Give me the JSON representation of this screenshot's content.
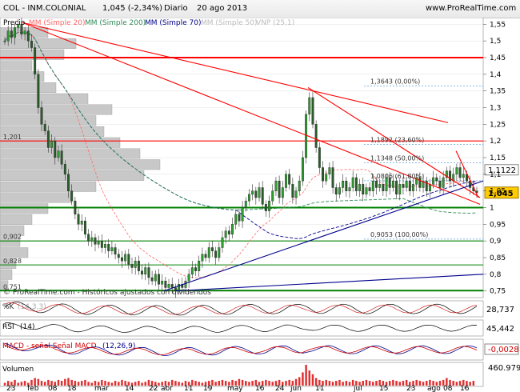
{
  "header": {
    "symbol": "COL - INM.COLONIAL",
    "quote": "1,045 (-2,34%)",
    "period": "Diario",
    "date": "20 ago 2013",
    "brand": "www.ProRealTime.com"
  },
  "legend": {
    "precio": "Precio",
    "mm20": "MM (Simple 20)",
    "mm200": "MM (Simple 200)",
    "mm70": "MM (Simple 70)",
    "mm50": "MM (Simple 50)",
    "vnp": "VNP (25,1)"
  },
  "footer_note": "© ProRealTime.com - Históricos ajustados con dividendos",
  "colors": {
    "resistance": "#ff0000",
    "support": "#008000",
    "trendline": "#00008b",
    "mm20": "#ff6666",
    "mm200": "#2e8b57",
    "mm70": "#00008b",
    "candle_up": "#2e9e2e",
    "candle_down": "#2a5d2a",
    "volume": "#e03030"
  },
  "chart_data": {
    "type": "candlestick",
    "y_ticks": [
      "1,55",
      "1,5",
      "1,45",
      "1,4",
      "1,35",
      "1,3",
      "1,25",
      "1,2",
      "1,15",
      "1,1",
      "1,05",
      "1",
      "0,95",
      "0,9",
      "0,85",
      "0,8",
      "0,75"
    ],
    "y_values": [
      1.55,
      1.5,
      1.45,
      1.4,
      1.35,
      1.3,
      1.25,
      1.2,
      1.15,
      1.1,
      1.05,
      1.0,
      0.95,
      0.9,
      0.85,
      0.8,
      0.75
    ],
    "ylim": [
      0.73,
      1.57
    ],
    "x_ticks": [
      "23",
      "feb",
      "08",
      "18",
      "mar",
      "14",
      "22",
      "abr",
      "11",
      "19",
      "may",
      "16",
      "24",
      "jun",
      "11",
      "jul",
      "15",
      "23",
      "ago",
      "08",
      "16"
    ],
    "price_levels": [
      {
        "label": "1,201",
        "value": 1.201
      },
      {
        "label": "0,902",
        "value": 0.902
      },
      {
        "label": "0,828",
        "value": 0.828
      },
      {
        "label": "0,751",
        "value": 0.751
      }
    ],
    "fibonacci": [
      {
        "label": "1,3643 (0,00%)",
        "value": 1.3643
      },
      {
        "label": "1,1892 (23,60%)",
        "value": 1.1892
      },
      {
        "label": "1,1348 (50,00%)",
        "value": 1.1348
      },
      {
        "label": "1,0806 (61,80%)",
        "value": 1.0806
      },
      {
        "label": "0,9053 (100,00%)",
        "value": 0.9053
      }
    ],
    "last_prices": [
      "1,1122",
      "1,045"
    ],
    "indicators": [
      {
        "name": "%K",
        "params": "(14,3,3)",
        "value": "28,737"
      },
      {
        "name": "RSI",
        "params": "(14)",
        "value": "45,442"
      },
      {
        "name": "MACD - señal Señal MACD",
        "params": "(12,26,9)",
        "value": "-0,0028"
      },
      {
        "name": "Volumen",
        "params": "",
        "value": "460.979"
      }
    ],
    "close": [
      1.5,
      1.53,
      1.51,
      1.54,
      1.55,
      1.52,
      1.53,
      1.5,
      1.48,
      1.4,
      1.3,
      1.25,
      1.23,
      1.18,
      1.2,
      1.15,
      1.17,
      1.13,
      1.1,
      1.05,
      1.02,
      0.98,
      0.95,
      0.96,
      0.92,
      0.9,
      0.91,
      0.89,
      0.9,
      0.88,
      0.89,
      0.87,
      0.88,
      0.86,
      0.85,
      0.84,
      0.86,
      0.83,
      0.82,
      0.84,
      0.81,
      0.8,
      0.82,
      0.79,
      0.78,
      0.8,
      0.77,
      0.78,
      0.76,
      0.77,
      0.76,
      0.75,
      0.77,
      0.76,
      0.78,
      0.8,
      0.82,
      0.81,
      0.84,
      0.86,
      0.85,
      0.88,
      0.87,
      0.85,
      0.88,
      0.91,
      0.93,
      0.92,
      0.95,
      0.98,
      0.96,
      1.0,
      1.02,
      1.04,
      1.05,
      1.03,
      1.06,
      1.01,
      0.99,
      1.02,
      1.05,
      1.08,
      1.03,
      1.06,
      1.1,
      1.07,
      1.03,
      1.05,
      1.08,
      1.15,
      1.28,
      1.33,
      1.25,
      1.18,
      1.12,
      1.08,
      1.1,
      1.12,
      1.06,
      1.04,
      1.06,
      1.08,
      1.05,
      1.06,
      1.09,
      1.05,
      1.07,
      1.04,
      1.06,
      1.05,
      1.08,
      1.06,
      1.07,
      1.05,
      1.09,
      1.06,
      1.08,
      1.04,
      1.07,
      1.06,
      1.08,
      1.05,
      1.07,
      1.09,
      1.06,
      1.08,
      1.05,
      1.07,
      1.09,
      1.08,
      1.06,
      1.09,
      1.11,
      1.08,
      1.1,
      1.12,
      1.09,
      1.1,
      1.08,
      1.06,
      1.05,
      1.045
    ],
    "volume": [
      3,
      5,
      4,
      6,
      3,
      4,
      5,
      3,
      6,
      8,
      7,
      5,
      4,
      6,
      5,
      4,
      6,
      5,
      7,
      8,
      6,
      5,
      4,
      5,
      6,
      4,
      3,
      5,
      4,
      6,
      5,
      4,
      3,
      5,
      4,
      6,
      5,
      4,
      3,
      4,
      5,
      3,
      4,
      6,
      5,
      4,
      3,
      4,
      5,
      4,
      6,
      5,
      4,
      3,
      5,
      4,
      6,
      5,
      4,
      3,
      4,
      5,
      6,
      4,
      5,
      6,
      5,
      4,
      6,
      5,
      7,
      6,
      5,
      4,
      5,
      6,
      4,
      5,
      6,
      5,
      4,
      5,
      6,
      4,
      5,
      6,
      5,
      7,
      9,
      14,
      22,
      16,
      12,
      8,
      6,
      5,
      6,
      5,
      4,
      5,
      6,
      4,
      5,
      4,
      6,
      5,
      4,
      5,
      6,
      5,
      4,
      5,
      6,
      5,
      4,
      5,
      6,
      5,
      4,
      5,
      6,
      4,
      5,
      6,
      5,
      4,
      5,
      6,
      5,
      4,
      5,
      6,
      8,
      6,
      5,
      4,
      5,
      6,
      5,
      4,
      5
    ]
  }
}
